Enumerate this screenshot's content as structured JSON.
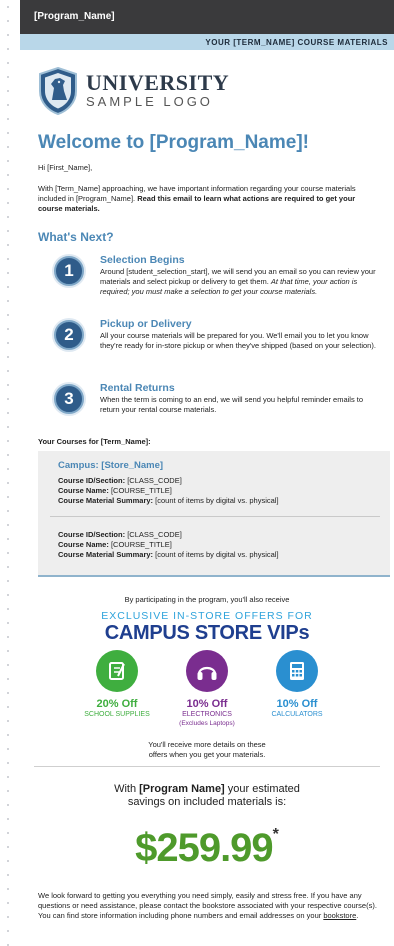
{
  "header": {
    "program_name": "[Program_Name]",
    "subbar": "YOUR [TERM_NAME] COURSE MATERIALS"
  },
  "logo": {
    "line1": "UNIVERSITY",
    "line2": "SAMPLE LOGO"
  },
  "welcome": "Welcome to [Program_Name]!",
  "greeting": "Hi [First_Name],",
  "intro": {
    "text": "With [Term_Name] approaching, we have important information regarding your course materials included in [Program_Name]. ",
    "bold": "Read this email to learn what actions are required to get your course materials."
  },
  "whats_next": "What's Next?",
  "steps": [
    {
      "number": "1",
      "title": "Selection Begins",
      "text": "Around [student_selection_start], we will send you an email so you can review your materials and select pickup or delivery to get them. ",
      "italic": "At that time, your action is required; you must make a selection to get your course materials."
    },
    {
      "number": "2",
      "title": "Pickup or Delivery",
      "text": "All your course materials will be prepared for you. We'll email you to let you know they're ready for in-store pickup or when they've shipped (based on your selection).",
      "italic": ""
    },
    {
      "number": "3",
      "title": "Rental Returns",
      "text": "When the term is coming to an end, we will send you helpful reminder emails to return your rental course materials.",
      "italic": ""
    }
  ],
  "courses": {
    "label": "Your Courses for [Term_Name]:",
    "campus": "Campus: [Store_Name]",
    "field_labels": {
      "id": "Course ID/Section:",
      "name": "Course Name:",
      "summary": "Course Material Summary:"
    },
    "items": [
      {
        "id": "[CLASS_CODE]",
        "name": "[COURSE_TITLE]",
        "summary": "[count of items by digital vs. physical]"
      },
      {
        "id": "[CLASS_CODE]",
        "name": "[COURSE_TITLE]",
        "summary": "[count of items by digital vs. physical]"
      }
    ]
  },
  "offers": {
    "intro": "By participating in the program, you'll also receive",
    "headline": "EXCLUSIVE IN-STORE OFFERS FOR",
    "title": "CAMPUS STORE VIPs",
    "items": [
      {
        "pct": "20% Off",
        "category": "SCHOOL SUPPLIES",
        "note": "",
        "color": "#3fae3f",
        "icon": "notebook-icon"
      },
      {
        "pct": "10% Off",
        "category": "ELECTRONICS",
        "note": "(Excludes Laptops)",
        "color": "#7a2d8f",
        "icon": "headphones-icon"
      },
      {
        "pct": "10% Off",
        "category": "CALCULATORS",
        "note": "",
        "color": "#2a8fd0",
        "icon": "calculator-icon"
      }
    ],
    "receive_line1": "You'll receive more details on these",
    "receive_line2": "offers when you get your materials."
  },
  "savings": {
    "pre": "With ",
    "program": "[Program Name]",
    "post": " your estimated",
    "line2": "savings on included materials is:",
    "price": "$259.99",
    "asterisk": "*"
  },
  "footer": {
    "text": "We look forward to getting you everything you need simply, easily and stress free. If you have any questions or need assistance, please contact the bookstore associated with your respective course(s). You can find store information including phone numbers and email addresses on your ",
    "link": "bookstore",
    "end": "."
  },
  "colors": {
    "accent": "#4b87b5",
    "topbar": "#3a3a3c",
    "subbar": "#b9d7e9",
    "price": "#4e9a2b"
  }
}
